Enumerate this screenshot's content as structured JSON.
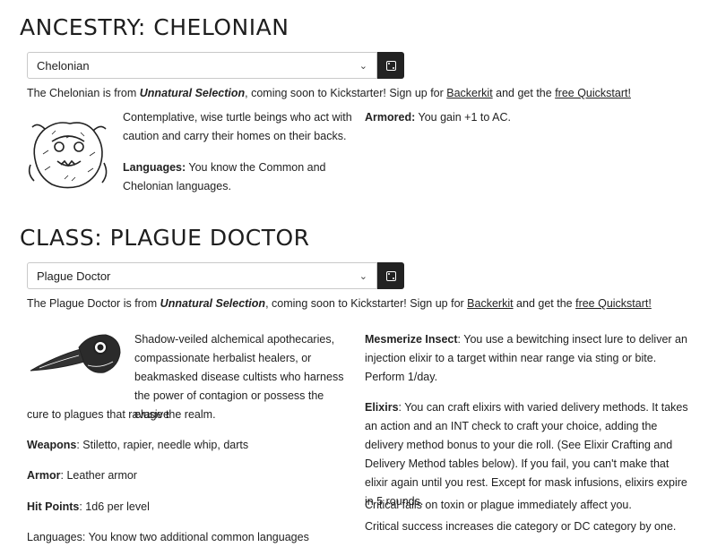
{
  "ancestry": {
    "heading": "ANCESTRY: CHELONIAN",
    "select_value": "Chelonian",
    "promo": {
      "prefix": "The Chelonian is from ",
      "book": "Unnatural Selection",
      "middle": ", coming soon to Kickstarter! Sign up for ",
      "link1": "Backerkit",
      "between": " and get the ",
      "link2": "free Quickstart!"
    },
    "description": "Contemplative, wise turtle beings who act with caution and carry their homes on their backs.",
    "languages_label": "Languages:",
    "languages_text": " You know the Common and Chelonian languages.",
    "armored_label": "Armored:",
    "armored_text": " You gain +1 to AC."
  },
  "class": {
    "heading": "CLASS: PLAGUE DOCTOR",
    "select_value": "Plague Doctor",
    "promo": {
      "prefix": "The Plague Doctor is from ",
      "book": "Unnatural Selection",
      "middle": ", coming soon to Kickstarter! Sign up for ",
      "link1": "Backerkit",
      "between": " and get the ",
      "link2": "free Quickstart!"
    },
    "description_a": "Shadow-veiled alchemical apothecaries, compassionate herbalist healers, or beakmasked disease cultists who harness the power of contagion or possess the elusive",
    "description_b": "cure to plagues that ravage the realm.",
    "weapons_label": "Weapons",
    "weapons_text": ": Stiletto, rapier, needle whip, darts",
    "armor_label": "Armor",
    "armor_text": ": Leather armor",
    "hp_label": "Hit Points",
    "hp_text": ": 1d6 per level",
    "languages_partial": "Languages: You know two additional common languages",
    "mesmerize_label": "Mesmerize Insect",
    "mesmerize_text": ": You use a bewitching insect lure to deliver an injection elixir to a target within near range via sting or bite. Perform 1/day.",
    "elixirs_label": "Elixirs",
    "elixirs_text": ": You can craft elixirs with varied delivery methods. It takes an action and an INT check to craft your choice, adding the delivery method bonus to your die roll. (See Elixir Crafting and Delivery Method tables below). If you fail, you can't make that elixir again until you rest. Except for mask infusions, elixirs expire in 5 rounds.",
    "crit_fail": "Critical fails on toxin or plague immediately affect you.",
    "crit_success": "Critical success increases die category or DC category by one."
  }
}
